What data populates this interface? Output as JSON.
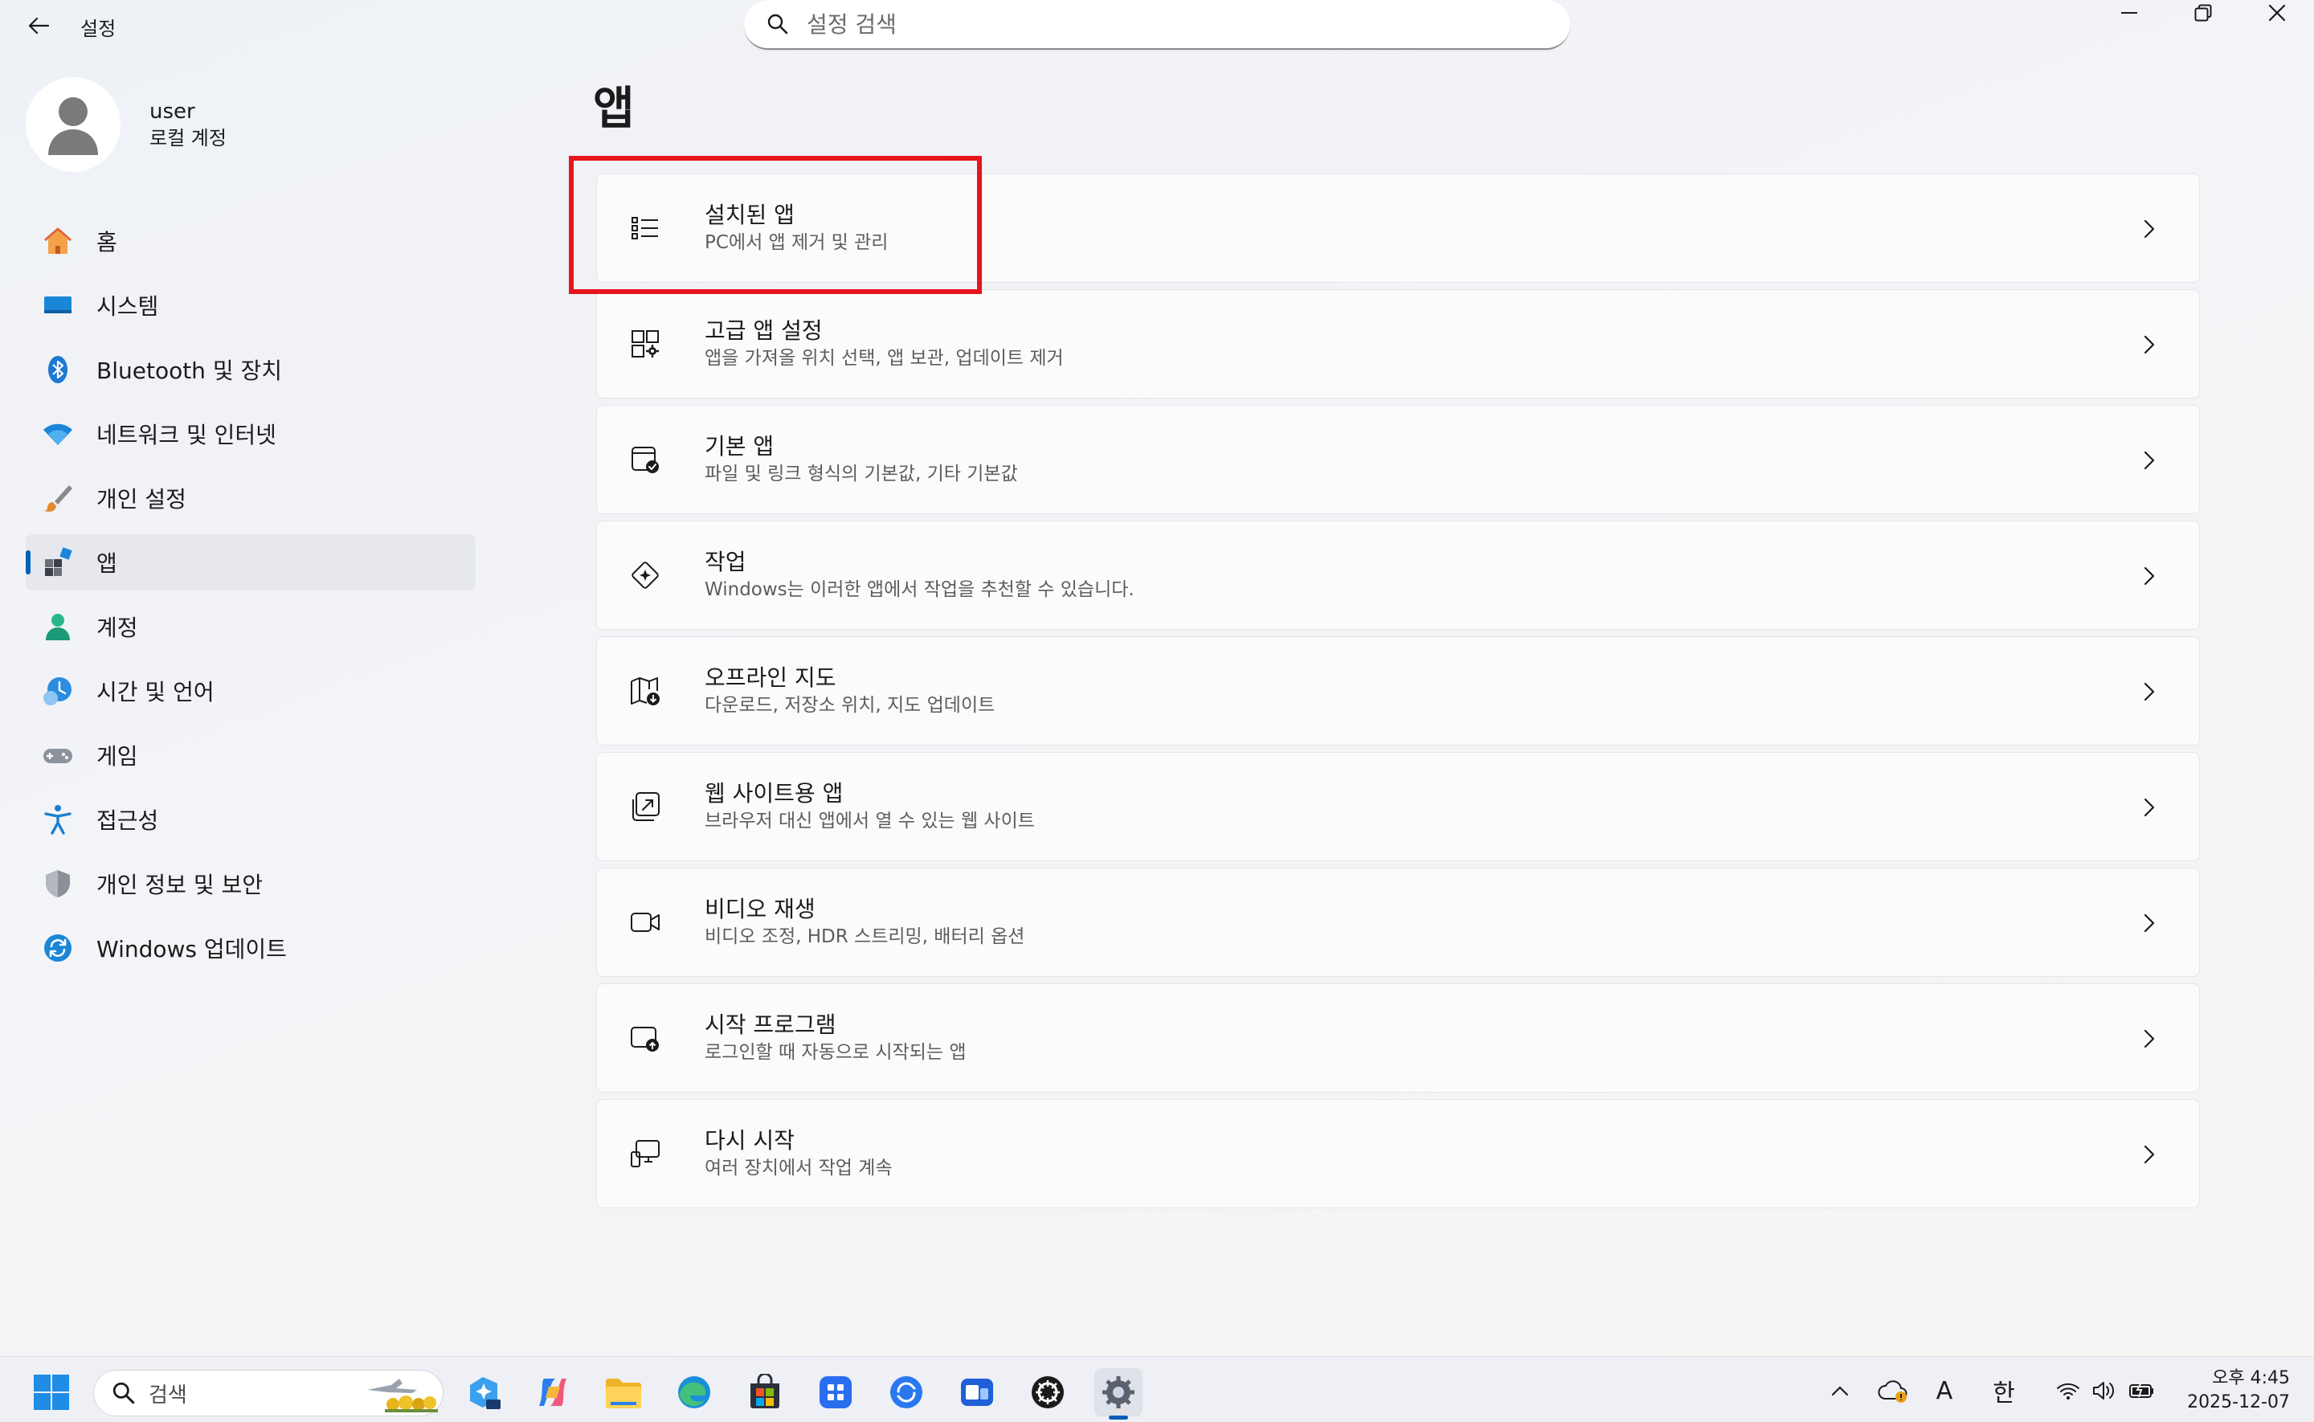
{
  "window": {
    "title": "설정",
    "search_placeholder": "설정 검색"
  },
  "profile": {
    "name": "user",
    "account_type": "로컬 계정"
  },
  "sidebar": {
    "items": [
      {
        "label": "홈",
        "icon": "home-icon"
      },
      {
        "label": "시스템",
        "icon": "system-icon"
      },
      {
        "label": "Bluetooth 및 장치",
        "icon": "bluetooth-icon"
      },
      {
        "label": "네트워크 및 인터넷",
        "icon": "wifi-icon"
      },
      {
        "label": "개인 설정",
        "icon": "brush-icon"
      },
      {
        "label": "앱",
        "icon": "apps-icon",
        "active": true
      },
      {
        "label": "계정",
        "icon": "account-icon"
      },
      {
        "label": "시간 및 언어",
        "icon": "clock-globe-icon"
      },
      {
        "label": "게임",
        "icon": "gamepad-icon"
      },
      {
        "label": "접근성",
        "icon": "accessibility-icon"
      },
      {
        "label": "개인 정보 및 보안",
        "icon": "shield-icon"
      },
      {
        "label": "Windows 업데이트",
        "icon": "update-icon"
      }
    ]
  },
  "main": {
    "title": "앱",
    "cards": [
      {
        "title": "설치된 앱",
        "subtitle": "PC에서 앱 제거 및 관리",
        "icon": "list-icon"
      },
      {
        "title": "고급 앱 설정",
        "subtitle": "앱을 가져올 위치 선택, 앱 보관, 업데이트 제거",
        "icon": "app-settings-icon"
      },
      {
        "title": "기본 앱",
        "subtitle": "파일 및 링크 형식의 기본값, 기타 기본값",
        "icon": "default-apps-icon"
      },
      {
        "title": "작업",
        "subtitle": "Windows는 이러한 앱에서 작업을 추천할 수 있습니다.",
        "icon": "actions-icon"
      },
      {
        "title": "오프라인 지도",
        "subtitle": "다운로드, 저장소 위치, 지도 업데이트",
        "icon": "map-icon"
      },
      {
        "title": "웹 사이트용 앱",
        "subtitle": "브라우저 대신 앱에서 열 수 있는 웹 사이트",
        "icon": "web-app-icon"
      },
      {
        "title": "비디오 재생",
        "subtitle": "비디오 조정, HDR 스트리밍, 배터리 옵션",
        "icon": "video-icon"
      },
      {
        "title": "시작 프로그램",
        "subtitle": "로그인할 때 자동으로 시작되는 앱",
        "icon": "startup-icon"
      },
      {
        "title": "다시 시작",
        "subtitle": "여러 장치에서 작업 계속",
        "icon": "resume-icon"
      }
    ]
  },
  "taskbar": {
    "search_label": "검색",
    "tray": {
      "ime_letter": "A",
      "ime_lang": "한"
    },
    "clock": {
      "time": "오후 4:45",
      "date": "2025-12-07"
    }
  },
  "colors": {
    "accent": "#005fb8",
    "highlight": "#e4161c"
  }
}
